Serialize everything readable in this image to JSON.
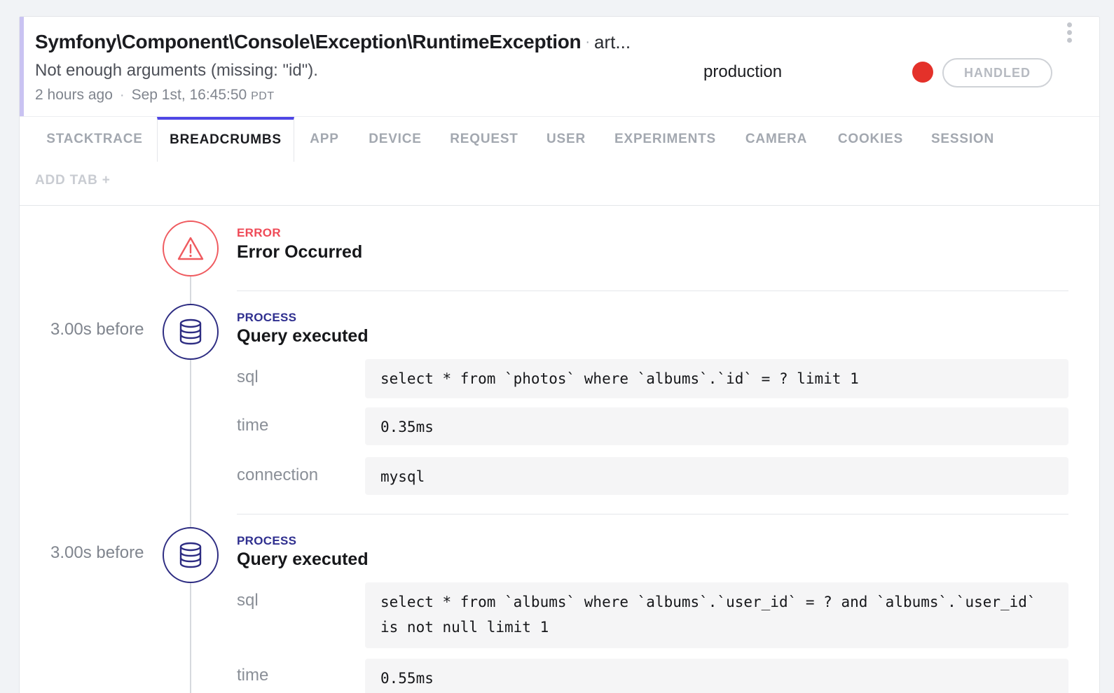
{
  "event": {
    "title": "Symfony\\Component\\Console\\Exception\\RuntimeException",
    "title_separator": "·",
    "culprit": "art...",
    "message": "Not enough arguments (missing: \"id\").",
    "time_ago": "2 hours ago",
    "meta_separator": "·",
    "timestamp": "Sep 1st, 16:45:50",
    "timezone": "PDT",
    "environment": "production",
    "level_color": "#e4312a",
    "handled_label": "HANDLED"
  },
  "tabs": [
    {
      "label": "STACKTRACE",
      "active": false
    },
    {
      "label": "BREADCRUMBS",
      "active": true
    },
    {
      "label": "APP",
      "active": false
    },
    {
      "label": "DEVICE",
      "active": false
    },
    {
      "label": "REQUEST",
      "active": false
    },
    {
      "label": "USER",
      "active": false
    },
    {
      "label": "EXPERIMENTS",
      "active": false
    },
    {
      "label": "CAMERA",
      "active": false
    },
    {
      "label": "COOKIES",
      "active": false
    },
    {
      "label": "SESSION",
      "active": false
    }
  ],
  "add_tab_label": "ADD TAB +",
  "breadcrumbs": [
    {
      "type": "ERROR",
      "title": "Error Occurred",
      "icon": "warning-triangle-icon"
    },
    {
      "relative_time": "3.00s before",
      "type": "PROCESS",
      "title": "Query executed",
      "icon": "database-icon",
      "fields": [
        {
          "key": "sql",
          "value": "select * from `photos` where `albums`.`id` = ? limit 1"
        },
        {
          "key": "time",
          "value": "0.35ms"
        },
        {
          "key": "connection",
          "value": "mysql"
        }
      ]
    },
    {
      "relative_time": "3.00s before",
      "type": "PROCESS",
      "title": "Query executed",
      "icon": "database-icon",
      "fields": [
        {
          "key": "sql",
          "value": "select * from `albums` where `albums`.`user_id` = ? and `albums`.`user_id` is not null limit 1"
        },
        {
          "key": "time",
          "value": "0.55ms"
        }
      ]
    }
  ],
  "colors": {
    "accent": "#4f46e5",
    "error": "#ef4a57",
    "process": "#2f2f8f",
    "header_bar": "#c9c3f2"
  }
}
